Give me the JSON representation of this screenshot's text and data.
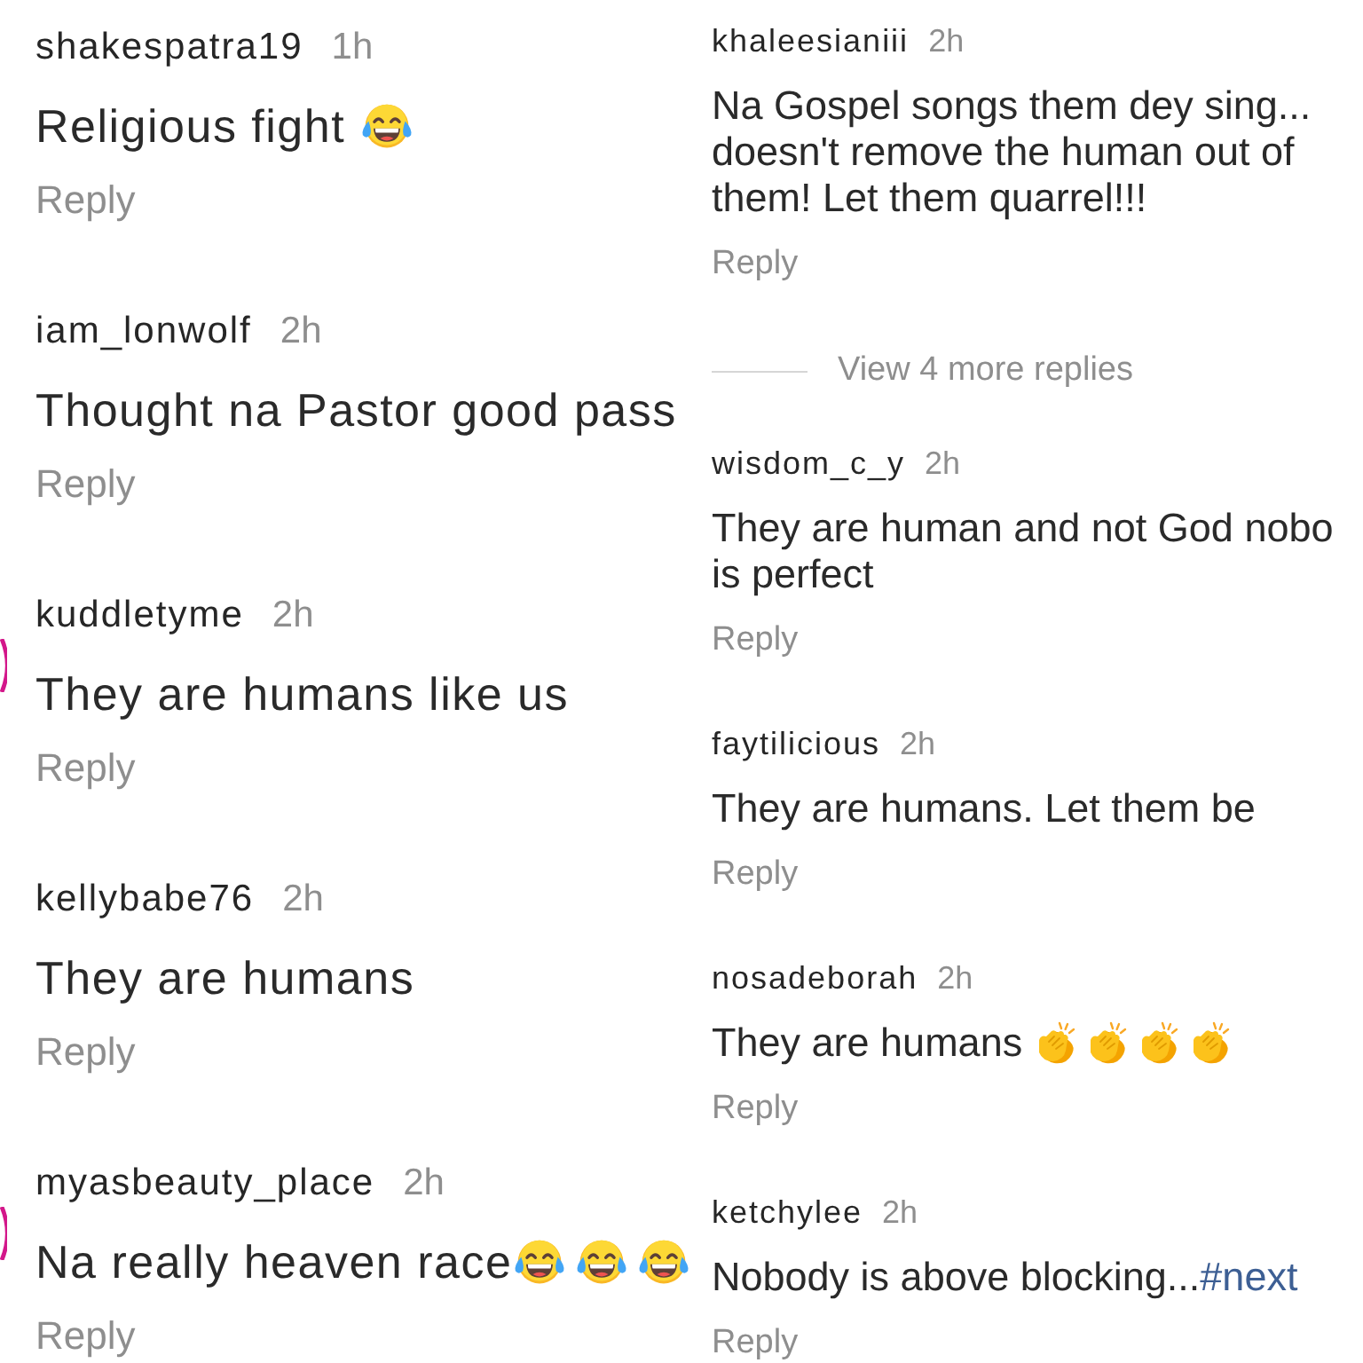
{
  "columns": [
    {
      "items": [
        {
          "kind": "comment",
          "username": "shakespatra19",
          "time": "1h",
          "lines": [
            "Religious fight "
          ],
          "emojis": [
            {
              "kind": "tears-of-joy"
            }
          ],
          "story_ring": false,
          "reply": "Reply"
        },
        {
          "kind": "comment",
          "username": "iam_lonwolf",
          "time": "2h",
          "lines": [
            "Thought na Pastor good pass"
          ],
          "story_ring": false,
          "reply": "Reply"
        },
        {
          "kind": "comment",
          "username": "kuddletyme",
          "time": "2h",
          "lines": [
            "They are humans like us"
          ],
          "story_ring": true,
          "reply": "Reply"
        },
        {
          "kind": "comment",
          "username": "kellybabe76",
          "time": "2h",
          "lines": [
            "They are humans"
          ],
          "story_ring": false,
          "reply": "Reply"
        },
        {
          "kind": "comment",
          "username": "myasbeauty_place",
          "time": "2h",
          "lines": [
            "Na really heaven race"
          ],
          "emojis": [
            {
              "kind": "tears-of-joy"
            },
            {
              "kind": "tears-of-joy"
            },
            {
              "kind": "tears-of-joy"
            }
          ],
          "story_ring": true,
          "reply": "Reply"
        }
      ]
    },
    {
      "items": [
        {
          "kind": "comment",
          "username": "khaleesianiii",
          "time": "2h",
          "lines": [
            "Na Gospel songs them dey sing...",
            "doesn't remove the human out of",
            "them! Let them quarrel!!!"
          ],
          "story_ring": false,
          "reply": "Reply"
        },
        {
          "kind": "more-replies",
          "label": "View 4 more replies"
        },
        {
          "kind": "comment",
          "username": "wisdom_c_y",
          "time": "2h",
          "lines": [
            "They are human and not God nobo",
            "is perfect"
          ],
          "story_ring": false,
          "reply": "Reply"
        },
        {
          "kind": "comment",
          "username": "faytilicious",
          "time": "2h",
          "lines": [
            "They are humans. Let them be"
          ],
          "story_ring": false,
          "reply": "Reply"
        },
        {
          "kind": "comment",
          "username": "nosadeborah",
          "time": "2h",
          "lines": [
            "They are humans "
          ],
          "emojis": [
            {
              "kind": "clapping-hands"
            },
            {
              "kind": "clapping-hands"
            },
            {
              "kind": "clapping-hands"
            },
            {
              "kind": "clapping-hands"
            }
          ],
          "story_ring": false,
          "reply": "Reply"
        },
        {
          "kind": "comment",
          "username": "ketchylee",
          "time": "2h",
          "lines": [
            "Nobody is above blocking..."
          ],
          "hashtag": "#next",
          "story_ring": false,
          "reply": "Reply"
        }
      ]
    }
  ]
}
